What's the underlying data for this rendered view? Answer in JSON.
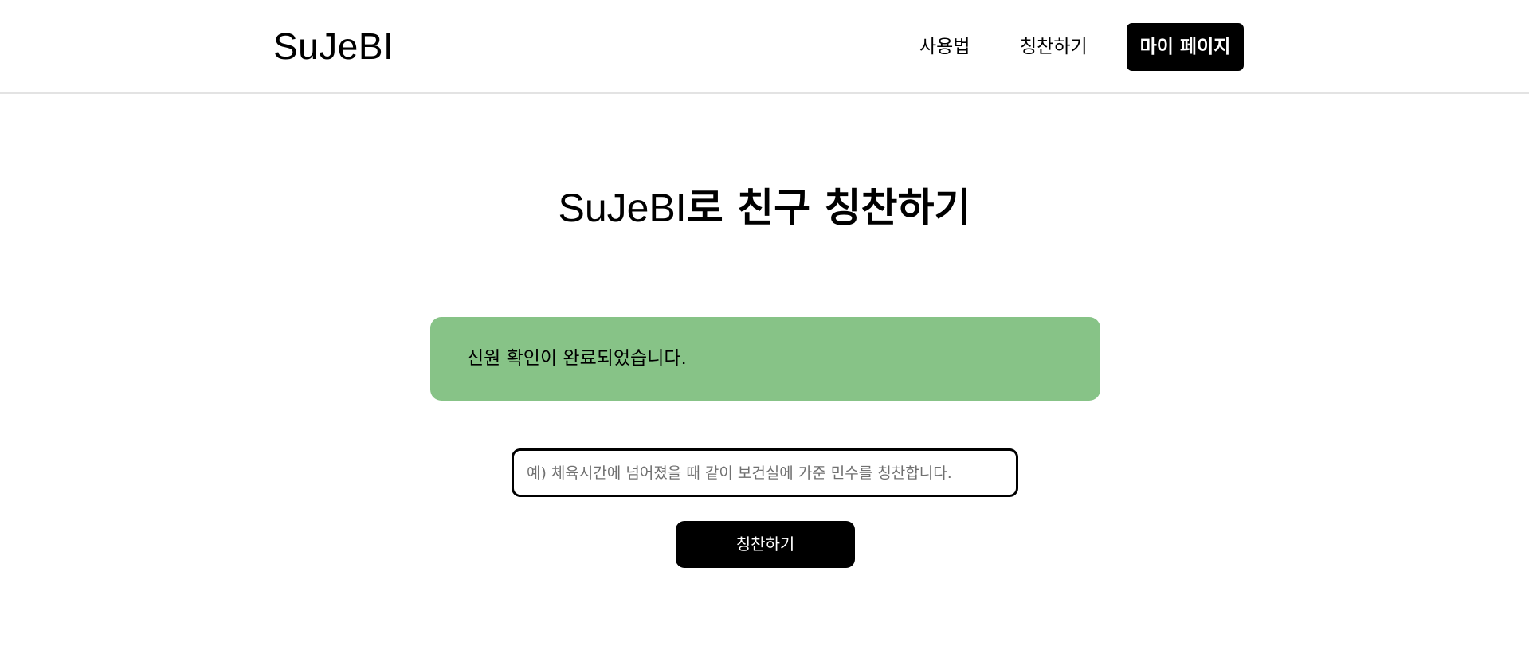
{
  "header": {
    "logo": "SuJeBI",
    "nav": {
      "usage_label": "사용법",
      "praise_label": "칭찬하기",
      "mypage_label": "마이 페이지"
    }
  },
  "main": {
    "title_brand": "SuJeBI",
    "title_rest": "로 친구 칭찬하기",
    "alert": {
      "message": "신원 확인이 완료되었습니다."
    },
    "praise_input": {
      "value": "",
      "placeholder": "예) 체육시간에 넘어졌을 때 같이 보건실에 가준 민수를 칭찬합니다."
    },
    "submit_label": "칭찬하기"
  },
  "colors": {
    "alert_background": "#87c387",
    "button_background": "#000000",
    "header_border": "#e3e3e3"
  }
}
